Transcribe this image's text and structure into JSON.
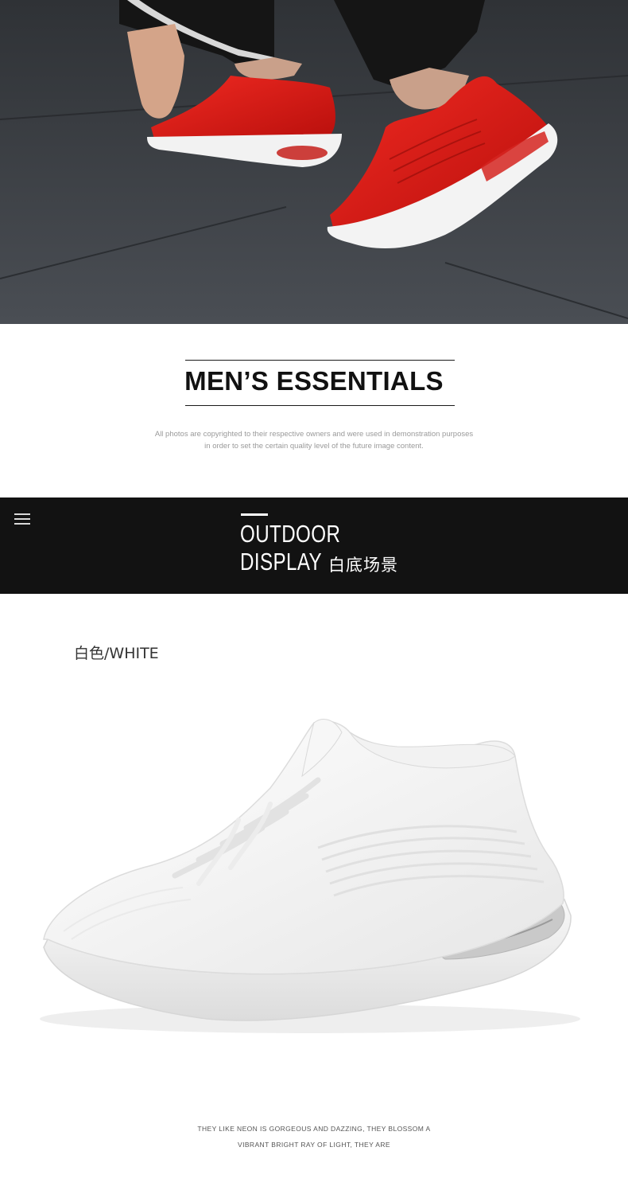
{
  "hero": {
    "image_description_icon": "red-sneakers-photo-icon"
  },
  "essentials": {
    "title": "MEN’S ESSENTIALS",
    "disclaimer_line1": "All photos are copyrighted to their respective owners and were used in  demonstration purposes",
    "disclaimer_line2": "in order to set the certain quality level of the future  image content."
  },
  "banner": {
    "menu_icon": "hamburger-menu-icon",
    "line1": "OUTDOOR",
    "line2": "DISPLAY",
    "subtitle_cn": "白底场景"
  },
  "product": {
    "color_label": "白色/WHITE",
    "shoe_icon": "white-sneaker-photo-icon"
  },
  "footer": {
    "tagline_line1": "THEY LIKE NEON IS GORGEOUS AND DAZZING, THEY BLOSSOM A",
    "tagline_line2": "VIBRANT BRIGHT RAY OF LIGHT, THEY ARE"
  },
  "colors": {
    "banner_bg": "#121212",
    "accent_red": "#e01a1a",
    "floor": "#3a3d42"
  }
}
